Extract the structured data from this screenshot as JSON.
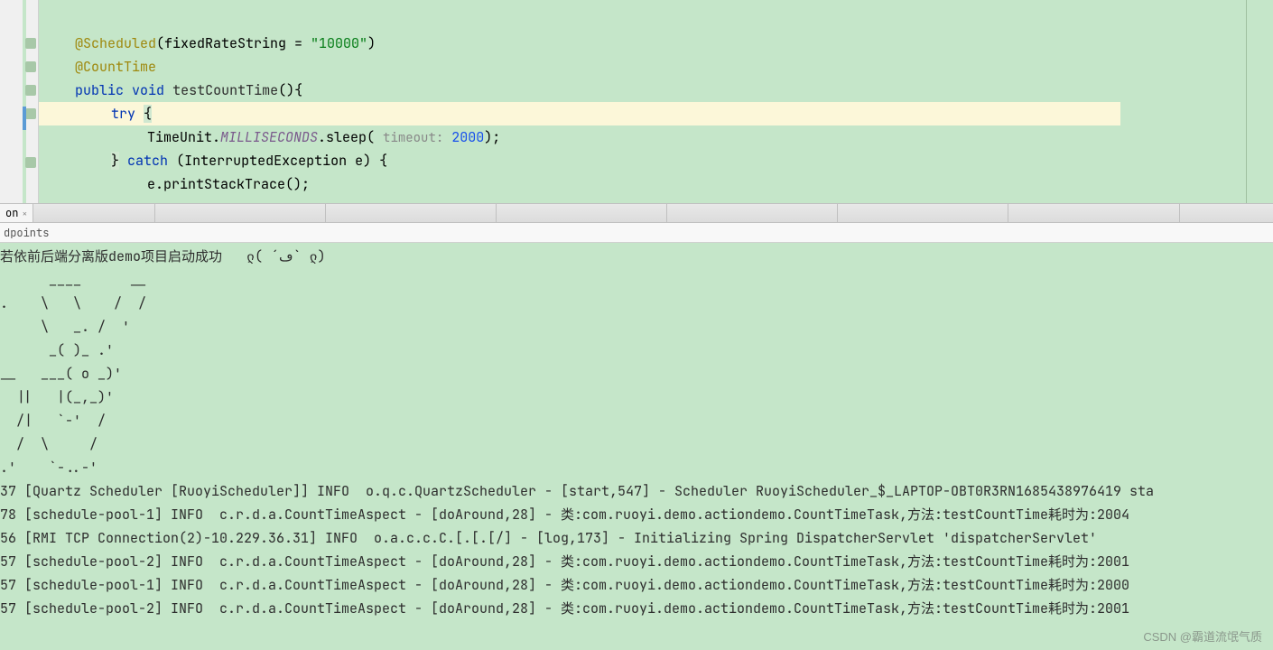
{
  "code": {
    "l1": {
      "anno": "@Scheduled",
      "paren_open": "(",
      "attr": "fixedRateString = ",
      "str": "\"10000\"",
      "paren_close": ")"
    },
    "l2": {
      "anno": "@CountTime"
    },
    "l3": {
      "kw1": "public",
      "sp1": " ",
      "kw2": "void",
      "sp2": " ",
      "method": "testCountTime",
      "rest": "(){"
    },
    "l4": {
      "kw": "try",
      "sp": " ",
      "brace": "{"
    },
    "l5": {
      "pre": "TimeUnit.",
      "fi": "MILLISECONDS",
      "mid": ".sleep( ",
      "hint": "timeout:",
      "sp": " ",
      "num": "2000",
      "end": ");"
    },
    "l6": {
      "brace": "}",
      "sp1": " ",
      "kw": "catch",
      "sp2": " ",
      "rest": "(InterruptedException e) {"
    },
    "l7": {
      "text": "e.printStackTrace();"
    }
  },
  "tab": {
    "label": "on",
    "close": "×"
  },
  "subbar": {
    "label": "dpoints"
  },
  "console": {
    "lines": [
      "若依前后端分离版demo项目启动成功   ლ( ´ڡ` ლ)",
      "      ____      __",
      ".    \\   \\    /  /",
      "     \\   _. /  '",
      "      _( )_ .'",
      "__   ___( o _)'",
      "  ||   |(_,_)'",
      "  /|   `-'  /",
      "  /  \\     /",
      ".'    `-..-'",
      "37 [Quartz Scheduler [RuoyiScheduler]] INFO  o.q.c.QuartzScheduler - [start,547] - Scheduler RuoyiScheduler_$_LAPTOP-OBT0R3RN1685438976419 sta",
      "78 [schedule-pool-1] INFO  c.r.d.a.CountTimeAspect - [doAround,28] - 类:com.ruoyi.demo.actiondemo.CountTimeTask,方法:testCountTime耗时为:2004",
      "56 [RMI TCP Connection(2)-10.229.36.31] INFO  o.a.c.c.C.[.[.[/] - [log,173] - Initializing Spring DispatcherServlet 'dispatcherServlet'",
      "57 [schedule-pool-2] INFO  c.r.d.a.CountTimeAspect - [doAround,28] - 类:com.ruoyi.demo.actiondemo.CountTimeTask,方法:testCountTime耗时为:2001",
      "57 [schedule-pool-1] INFO  c.r.d.a.CountTimeAspect - [doAround,28] - 类:com.ruoyi.demo.actiondemo.CountTimeTask,方法:testCountTime耗时为:2000",
      "57 [schedule-pool-2] INFO  c.r.d.a.CountTimeAspect - [doAround,28] - 类:com.ruoyi.demo.actiondemo.CountTimeTask,方法:testCountTime耗时为:2001"
    ]
  },
  "watermark": "CSDN @霸道流氓气质"
}
